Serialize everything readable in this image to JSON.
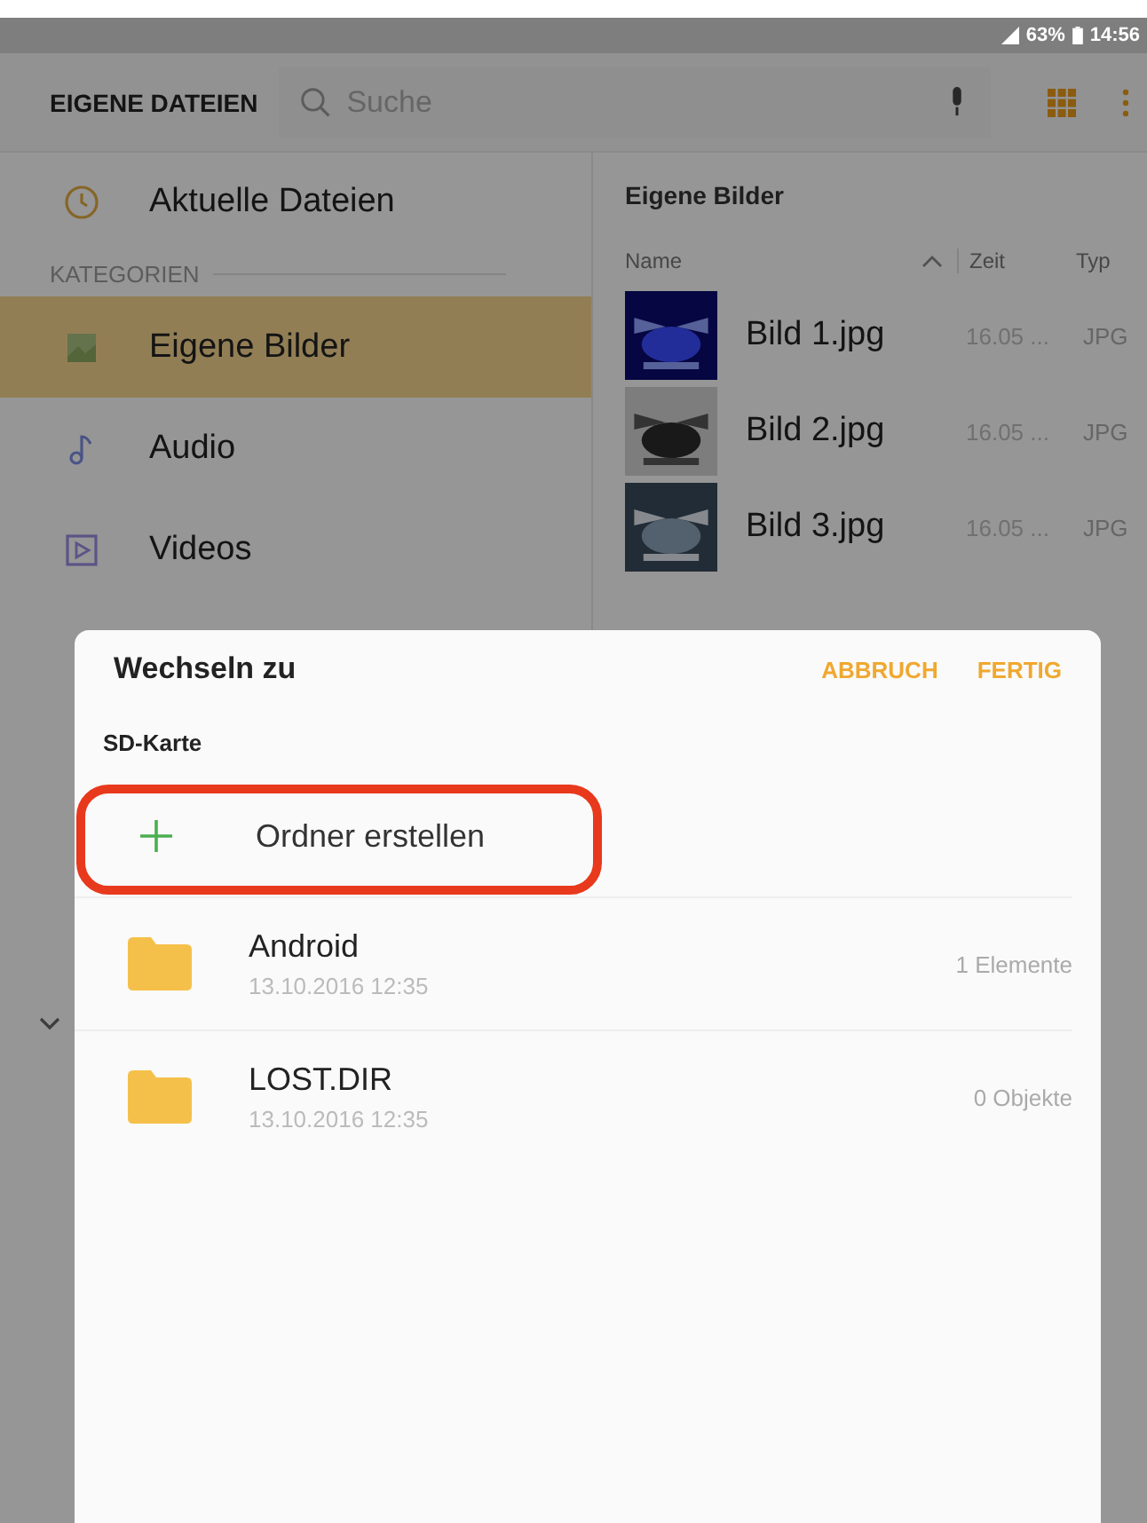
{
  "status_bar": {
    "battery": "63%",
    "time": "14:56"
  },
  "toolbar": {
    "title": "EIGENE DATEIEN",
    "search": {
      "placeholder": "Suche"
    }
  },
  "sidebar": {
    "recent": "Aktuelle Dateien",
    "section": "KATEGORIEN",
    "items": [
      {
        "label": "Eigene Bilder",
        "kind": "images",
        "selected": true
      },
      {
        "label": "Audio",
        "kind": "audio",
        "selected": false
      },
      {
        "label": "Videos",
        "kind": "videos",
        "selected": false
      }
    ]
  },
  "file_list": {
    "title": "Eigene Bilder",
    "columns": [
      "Name",
      "Zeit",
      "Typ"
    ],
    "rows": [
      {
        "name": "Bild 1.jpg",
        "time": "16.05 ...",
        "type": "JPG"
      },
      {
        "name": "Bild 2.jpg",
        "time": "16.05 ...",
        "type": "JPG"
      },
      {
        "name": "Bild 3.jpg",
        "time": "16.05 ...",
        "type": "JPG"
      }
    ]
  },
  "dialog": {
    "title": "Wechseln zu",
    "buttons": [
      "ABBRUCH",
      "FERTIG"
    ],
    "location": "SD-Karte",
    "create_folder": "Ordner erstellen",
    "highlighted": true,
    "folders": [
      {
        "name": "Android",
        "date": "13.10.2016 12:35",
        "count": "1 Elemente"
      },
      {
        "name": "LOST.DIR",
        "date": "13.10.2016 12:35",
        "count": "0 Objekte"
      }
    ]
  }
}
